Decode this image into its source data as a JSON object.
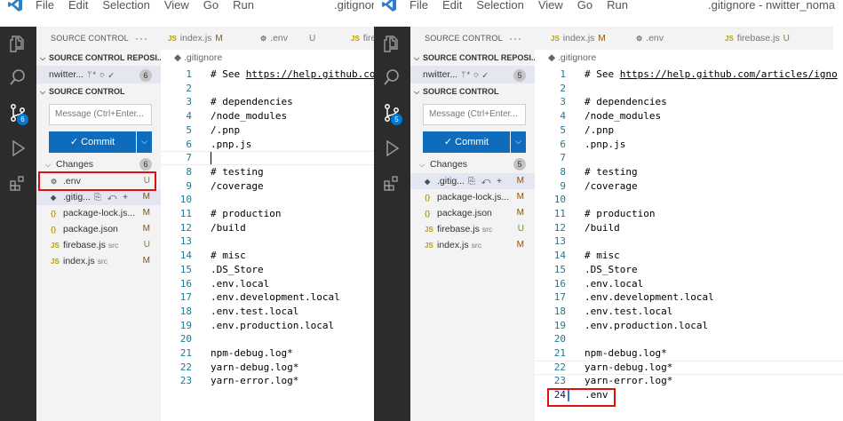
{
  "menu": [
    "File",
    "Edit",
    "Selection",
    "View",
    "Go",
    "Run"
  ],
  "panes": [
    {
      "window_title": ".gitignor",
      "sidebar": {
        "header": "SOURCE CONTROL",
        "more": "···",
        "repos_title": "SOURCE CONTROL REPOSI...",
        "repo_name": "nwitter...",
        "repo_rest": "ᛘ* ⟳ ✓",
        "repo_count": "6",
        "sc_title": "SOURCE CONTROL",
        "message_placeholder": "Message (Ctrl+Enter...",
        "commit_label": "✓ Commit",
        "commit_drop": "⌵",
        "changes_label": "Changes",
        "changes_count": "6",
        "files": [
          {
            "icon": "⚙",
            "name": ".env",
            "dir": "",
            "status": "U",
            "acts": ""
          },
          {
            "icon": "◆",
            "name": ".gitig...",
            "dir": "",
            "status": "M",
            "acts": "⎘ ↶ +"
          },
          {
            "icon": "{}",
            "name": "package-lock.js...",
            "dir": "",
            "status": "M",
            "acts": ""
          },
          {
            "icon": "{}",
            "name": "package.json",
            "dir": "",
            "status": "M",
            "acts": ""
          },
          {
            "icon": "JS",
            "name": "firebase.js",
            "dir": "src",
            "status": "U",
            "acts": ""
          },
          {
            "icon": "JS",
            "name": "index.js",
            "dir": "src",
            "status": "M",
            "acts": ""
          }
        ]
      },
      "tabs": [
        {
          "icon": "JS",
          "name": "index.js",
          "status": "M"
        },
        {
          "icon": "⚙",
          "name": ".env",
          "status": "U"
        },
        {
          "icon": "JS",
          "name": "fire",
          "status": ""
        }
      ],
      "breadcrumb": "◆ .gitignore",
      "lines": [
        {
          "n": "1",
          "t": "# See https://help.github.com"
        },
        {
          "n": "2",
          "t": ""
        },
        {
          "n": "3",
          "t": "# dependencies"
        },
        {
          "n": "4",
          "t": "/node_modules"
        },
        {
          "n": "5",
          "t": "/.pnp"
        },
        {
          "n": "6",
          "t": ".pnp.js"
        },
        {
          "n": "7",
          "t": ""
        },
        {
          "n": "8",
          "t": "# testing"
        },
        {
          "n": "9",
          "t": "/coverage"
        },
        {
          "n": "10",
          "t": ""
        },
        {
          "n": "11",
          "t": "# production"
        },
        {
          "n": "12",
          "t": "/build"
        },
        {
          "n": "13",
          "t": ""
        },
        {
          "n": "14",
          "t": "# misc"
        },
        {
          "n": "15",
          "t": ".DS_Store"
        },
        {
          "n": "16",
          "t": ".env.local"
        },
        {
          "n": "17",
          "t": ".env.development.local"
        },
        {
          "n": "18",
          "t": ".env.test.local"
        },
        {
          "n": "19",
          "t": ".env.production.local"
        },
        {
          "n": "20",
          "t": ""
        },
        {
          "n": "21",
          "t": "npm-debug.log*"
        },
        {
          "n": "22",
          "t": "yarn-debug.log*"
        },
        {
          "n": "23",
          "t": "yarn-error.log*"
        }
      ]
    },
    {
      "window_title": ".gitignore - nwitter_noma",
      "sidebar": {
        "header": "SOURCE CONTROL",
        "more": "···",
        "repos_title": "SOURCE CONTROL REPOSI...",
        "repo_name": "nwitter...",
        "repo_rest": "ᛘ* ⟳ ✓",
        "repo_count": "5",
        "sc_title": "SOURCE CONTROL",
        "message_placeholder": "Message (Ctrl+Enter...",
        "commit_label": "✓ Commit",
        "commit_drop": "⌵",
        "changes_label": "Changes",
        "changes_count": "5",
        "files": [
          {
            "icon": "◆",
            "name": ".gitig...",
            "dir": "",
            "status": "M",
            "acts": "⎘ ↶ +"
          },
          {
            "icon": "{}",
            "name": "package-lock.js...",
            "dir": "",
            "status": "M",
            "acts": ""
          },
          {
            "icon": "{}",
            "name": "package.json",
            "dir": "",
            "status": "M",
            "acts": ""
          },
          {
            "icon": "JS",
            "name": "firebase.js",
            "dir": "src",
            "status": "U",
            "acts": ""
          },
          {
            "icon": "JS",
            "name": "index.js",
            "dir": "src",
            "status": "M",
            "acts": ""
          }
        ]
      },
      "tabs": [
        {
          "icon": "JS",
          "name": "index.js",
          "status": "M"
        },
        {
          "icon": "⚙",
          "name": ".env",
          "status": ""
        },
        {
          "icon": "JS",
          "name": "firebase.js",
          "status": "U"
        }
      ],
      "breadcrumb": "◆ .gitignore",
      "lines": [
        {
          "n": "1",
          "t": "# See https://help.github.com/articles/igno"
        },
        {
          "n": "2",
          "t": ""
        },
        {
          "n": "3",
          "t": "# dependencies"
        },
        {
          "n": "4",
          "t": "/node_modules"
        },
        {
          "n": "5",
          "t": "/.pnp"
        },
        {
          "n": "6",
          "t": ".pnp.js"
        },
        {
          "n": "7",
          "t": ""
        },
        {
          "n": "8",
          "t": "# testing"
        },
        {
          "n": "9",
          "t": "/coverage"
        },
        {
          "n": "10",
          "t": ""
        },
        {
          "n": "11",
          "t": "# production"
        },
        {
          "n": "12",
          "t": "/build"
        },
        {
          "n": "13",
          "t": ""
        },
        {
          "n": "14",
          "t": "# misc"
        },
        {
          "n": "15",
          "t": ".DS_Store"
        },
        {
          "n": "16",
          "t": ".env.local"
        },
        {
          "n": "17",
          "t": ".env.development.local"
        },
        {
          "n": "18",
          "t": ".env.test.local"
        },
        {
          "n": "19",
          "t": ".env.production.local"
        },
        {
          "n": "20",
          "t": ""
        },
        {
          "n": "21",
          "t": "npm-debug.log*"
        },
        {
          "n": "22",
          "t": "yarn-debug.log*"
        },
        {
          "n": "23",
          "t": "yarn-error.log*"
        },
        {
          "n": "24",
          "t": ".env"
        }
      ]
    }
  ],
  "colors": {
    "accent": "#0f6cbd",
    "badge": "#0078d4",
    "comment": "#008000",
    "highlight_box": "#e01010",
    "line_number": "#237893"
  }
}
